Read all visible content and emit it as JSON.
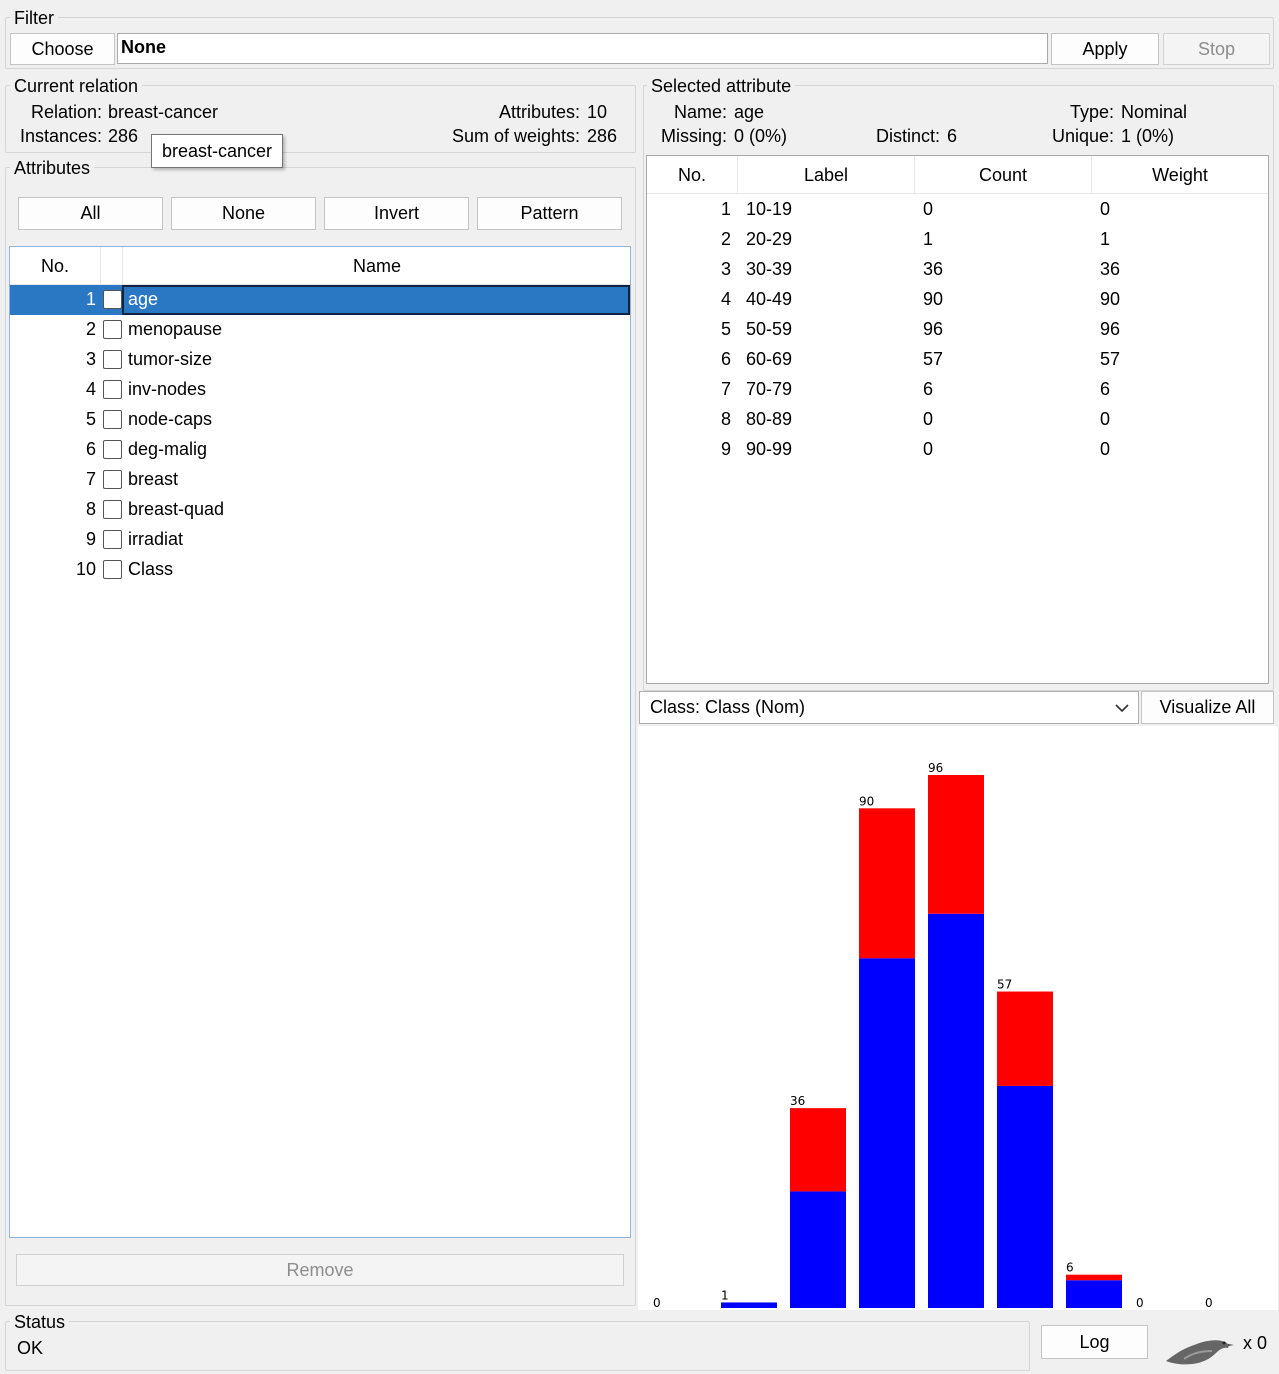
{
  "filter": {
    "legend": "Filter",
    "choose_label": "Choose",
    "value": "None",
    "apply_label": "Apply",
    "stop_label": "Stop"
  },
  "relation": {
    "legend": "Current relation",
    "relation_label": "Relation:",
    "relation_value": "breast-cancer",
    "instances_label": "Instances:",
    "instances_value": "286",
    "attributes_label": "Attributes:",
    "attributes_value": "10",
    "sumw_label": "Sum of weights:",
    "sumw_value": "286",
    "tooltip": "breast-cancer"
  },
  "attributes": {
    "legend": "Attributes",
    "buttons": [
      "All",
      "None",
      "Invert",
      "Pattern"
    ],
    "col_no": "No.",
    "col_name": "Name",
    "rows": [
      {
        "no": "1",
        "name": "age"
      },
      {
        "no": "2",
        "name": "menopause"
      },
      {
        "no": "3",
        "name": "tumor-size"
      },
      {
        "no": "4",
        "name": "inv-nodes"
      },
      {
        "no": "5",
        "name": "node-caps"
      },
      {
        "no": "6",
        "name": "deg-malig"
      },
      {
        "no": "7",
        "name": "breast"
      },
      {
        "no": "8",
        "name": "breast-quad"
      },
      {
        "no": "9",
        "name": "irradiat"
      },
      {
        "no": "10",
        "name": "Class"
      }
    ],
    "remove_label": "Remove"
  },
  "selected": {
    "legend": "Selected attribute",
    "name_label": "Name:",
    "name_value": "age",
    "type_label": "Type:",
    "type_value": "Nominal",
    "missing_label": "Missing:",
    "missing_value": "0 (0%)",
    "distinct_label": "Distinct:",
    "distinct_value": "6",
    "unique_label": "Unique:",
    "unique_value": "1 (0%)",
    "cols": [
      "No.",
      "Label",
      "Count",
      "Weight"
    ],
    "rows": [
      {
        "no": "1",
        "label": "10-19",
        "count": "0",
        "weight": "0"
      },
      {
        "no": "2",
        "label": "20-29",
        "count": "1",
        "weight": "1"
      },
      {
        "no": "3",
        "label": "30-39",
        "count": "36",
        "weight": "36"
      },
      {
        "no": "4",
        "label": "40-49",
        "count": "90",
        "weight": "90"
      },
      {
        "no": "5",
        "label": "50-59",
        "count": "96",
        "weight": "96"
      },
      {
        "no": "6",
        "label": "60-69",
        "count": "57",
        "weight": "57"
      },
      {
        "no": "7",
        "label": "70-79",
        "count": "6",
        "weight": "6"
      },
      {
        "no": "8",
        "label": "80-89",
        "count": "0",
        "weight": "0"
      },
      {
        "no": "9",
        "label": "90-99",
        "count": "0",
        "weight": "0"
      }
    ]
  },
  "class_select": {
    "value": "Class: Class (Nom)",
    "visualize_label": "Visualize All"
  },
  "status": {
    "legend": "Status",
    "text": "OK",
    "log_label": "Log",
    "x_count": "x 0"
  },
  "colors": {
    "blue": "#0000ff",
    "red": "#ff0000",
    "selection": "#2a78c4"
  },
  "chart_data": {
    "type": "bar",
    "categories": [
      "10-19",
      "20-29",
      "30-39",
      "40-49",
      "50-59",
      "60-69",
      "70-79",
      "80-89",
      "90-99"
    ],
    "totals": [
      0,
      1,
      36,
      90,
      96,
      57,
      6,
      0,
      0
    ],
    "series": [
      {
        "values": [
          0,
          1,
          21,
          63,
          71,
          40,
          5,
          0,
          0
        ]
      },
      {
        "values": [
          0,
          0,
          15,
          27,
          25,
          17,
          1,
          0,
          0
        ]
      }
    ],
    "ylim": [
      0,
      96
    ]
  }
}
